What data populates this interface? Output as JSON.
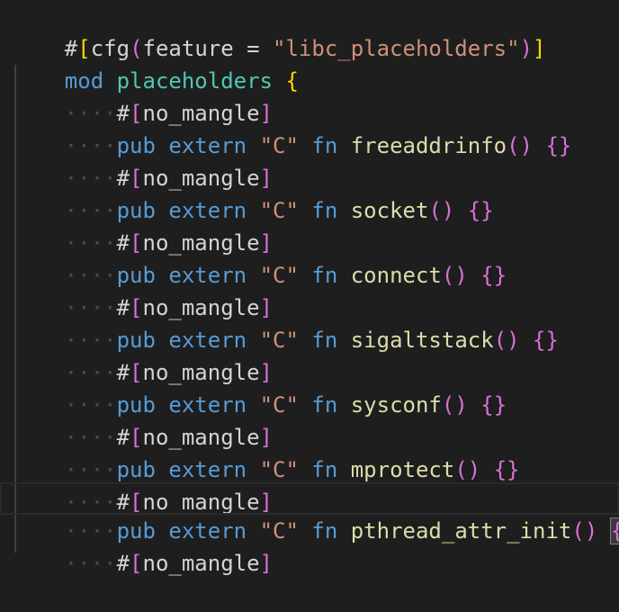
{
  "editor": {
    "language": "Rust",
    "colors": {
      "background": "#1e1e1e",
      "keyword": "#569cd6",
      "string": "#ce9178",
      "function": "#dcdcaa",
      "module": "#4ec9b0",
      "bracket_level1": "#ffd700",
      "bracket_level2": "#da70d6",
      "text": "#d4d4d4"
    },
    "lines": {
      "l0": {
        "hash": "#",
        "open": "[",
        "cfg": "cfg",
        "p_open": "(",
        "feature": "feature = ",
        "value": "\"libc_placeholders\"",
        "p_close": ")",
        "close": "]"
      },
      "l1": {
        "mod": "mod",
        "name": "placeholders",
        "brace": "{"
      },
      "l2": {
        "dots": "····",
        "hash": "#",
        "open": "[",
        "attr": "no_mangle",
        "close": "]"
      },
      "l3": {
        "dots": "····",
        "pub": "pub",
        "extern": "extern",
        "abi": "\"C\"",
        "fn": "fn",
        "name": "freeaddrinfo",
        "parens": "()",
        "body": "{}"
      },
      "l4": {
        "dots": "····",
        "hash": "#",
        "open": "[",
        "attr": "no_mangle",
        "close": "]"
      },
      "l5": {
        "dots": "····",
        "pub": "pub",
        "extern": "extern",
        "abi": "\"C\"",
        "fn": "fn",
        "name": "socket",
        "parens": "()",
        "body": "{}"
      },
      "l6": {
        "dots": "····",
        "hash": "#",
        "open": "[",
        "attr": "no_mangle",
        "close": "]"
      },
      "l7": {
        "dots": "····",
        "pub": "pub",
        "extern": "extern",
        "abi": "\"C\"",
        "fn": "fn",
        "name": "connect",
        "parens": "()",
        "body": "{}"
      },
      "l8": {
        "dots": "····",
        "hash": "#",
        "open": "[",
        "attr": "no_mangle",
        "close": "]"
      },
      "l9": {
        "dots": "····",
        "pub": "pub",
        "extern": "extern",
        "abi": "\"C\"",
        "fn": "fn",
        "name": "sigaltstack",
        "parens": "()",
        "body": "{}"
      },
      "l10": {
        "dots": "····",
        "hash": "#",
        "open": "[",
        "attr": "no_mangle",
        "close": "]"
      },
      "l11": {
        "dots": "····",
        "pub": "pub",
        "extern": "extern",
        "abi": "\"C\"",
        "fn": "fn",
        "name": "sysconf",
        "parens": "()",
        "body": "{}"
      },
      "l12": {
        "dots": "····",
        "hash": "#",
        "open": "[",
        "attr": "no_mangle",
        "close": "]"
      },
      "l13": {
        "dots": "····",
        "pub": "pub",
        "extern": "extern",
        "abi": "\"C\"",
        "fn": "fn",
        "name": "mprotect",
        "parens": "()",
        "body": "{}"
      },
      "l14": {
        "dots": "····",
        "hash": "#",
        "open": "[",
        "attr": "no_mangle",
        "close": "]"
      },
      "l15": {
        "dots": "····",
        "pub": "pub",
        "extern": "extern",
        "abi": "\"C\"",
        "fn": "fn",
        "name": "pthread_attr_init",
        "parens": "()",
        "body_open": "{",
        "body_close": "}"
      },
      "l16": {
        "dots": "····",
        "hash": "#",
        "open": "[",
        "attr": "no_mangle",
        "close": "]"
      }
    }
  }
}
